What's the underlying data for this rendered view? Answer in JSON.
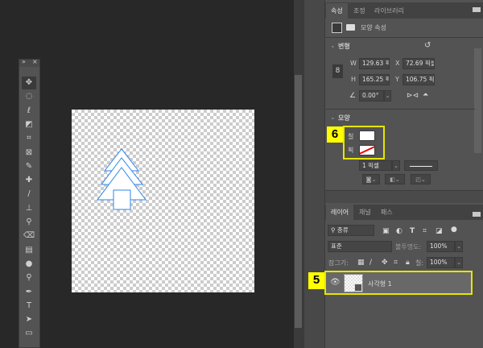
{
  "toolbar": {
    "collapse": "»",
    "close": "×",
    "tools": [
      "move",
      "marquee",
      "lasso",
      "object-select",
      "crop",
      "frame",
      "eyedropper",
      "healing",
      "brush",
      "stamp",
      "history-brush",
      "eraser",
      "gradient",
      "blur",
      "dodge",
      "pen",
      "type",
      "path-select",
      "rectangle"
    ],
    "glyphs": [
      "✥",
      "◌",
      "ℓ",
      "◩",
      "⌗",
      "⊠",
      "✎",
      "✚",
      "/",
      "⊥",
      "⚲",
      "⌫",
      "▤",
      "●",
      "⚲",
      "✒",
      "T",
      "➤",
      "▭"
    ]
  },
  "properties": {
    "tabs": [
      "속성",
      "조정",
      "라이브러리"
    ],
    "header": "모양 속성",
    "transform": {
      "title": "변형",
      "w_label": "W",
      "w": "129.63 픽셀",
      "x_label": "X",
      "x": "72.69 픽셀",
      "h_label": "H",
      "h": "165.25 픽셀",
      "y_label": "Y",
      "y": "106.75 픽셀",
      "angle": "0.00°"
    },
    "shape": {
      "title": "모양",
      "fill_label": "칠",
      "stroke_label": "획",
      "stroke_width": "1 픽셀",
      "fill_color": "#ffffff"
    }
  },
  "layers": {
    "tabs": [
      "레이어",
      "채널",
      "패스"
    ],
    "filter": "종류",
    "blend_mode": "표준",
    "opacity_label": "불투명도:",
    "opacity": "100%",
    "lock_label": "잠그기:",
    "fill_label": "칠:",
    "fill": "100%",
    "items": [
      {
        "name": "사각형 1",
        "visible": true
      }
    ]
  },
  "annotations": {
    "layer_badge": "5",
    "shape_badge": "6",
    "highlight_color": "#ffff00"
  },
  "colors": {
    "shape_stroke": "#2f86e8"
  }
}
